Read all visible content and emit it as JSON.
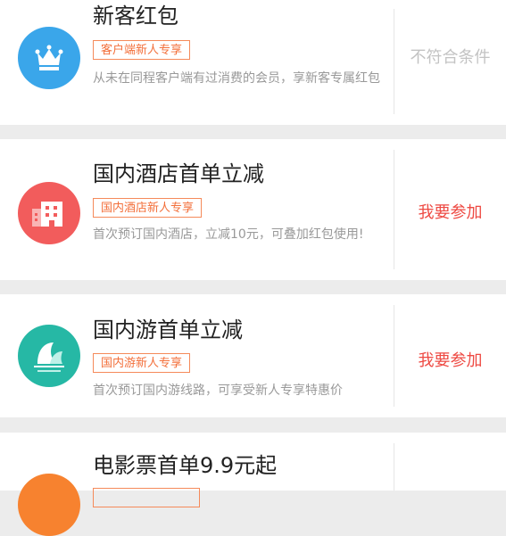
{
  "promotions": [
    {
      "title": "新客红包",
      "tag": "客户端新人专享",
      "description": "从未在同程客户端有过消费的会员，享新客专属红包",
      "action": "不符合条件",
      "icon": "crown-icon",
      "icon_color": "#3aa6ea"
    },
    {
      "title": "国内酒店首单立减",
      "tag": "国内酒店新人专享",
      "description": "首次预订国内酒店，立减10元，可叠加红包使用!",
      "action": "我要参加",
      "icon": "hotel-icon",
      "icon_color": "#f25c5c"
    },
    {
      "title": "国内游首单立减",
      "tag": "国内游新人专享",
      "description": "首次预订国内游线路，可享受新人专享特惠价",
      "action": "我要参加",
      "icon": "opera-house-icon",
      "icon_color": "#26b8a5"
    },
    {
      "title": "电影票首单9.9元起",
      "tag": "",
      "description": "",
      "action": "",
      "icon": "movie-icon",
      "icon_color": "#f7822f"
    }
  ],
  "colors": {
    "tag": "#f36f3a",
    "join_action": "#ee4a43",
    "disabled_action": "#c3c3c3",
    "background": "#ececec"
  }
}
